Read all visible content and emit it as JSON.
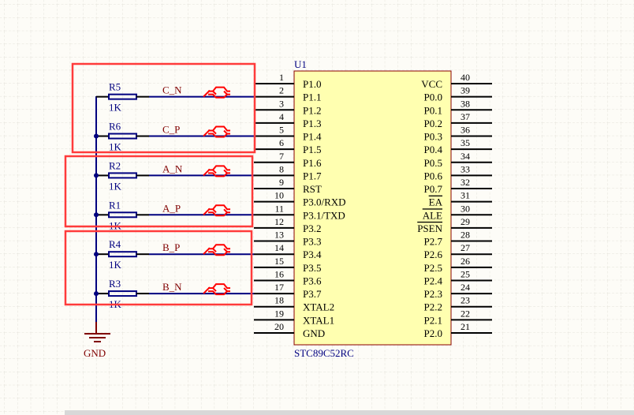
{
  "colors": {
    "background": "#fdfcf7",
    "grid": "#e4e2da",
    "wire": "#00007f",
    "pin": "#000000",
    "chip_fill": "#ffffb0",
    "chip_border": "#8b0000",
    "ref_text": "#000080",
    "net_text": "#800000",
    "highlight_box": "#ff3b3b",
    "port_symbol": "#ff0000"
  },
  "chip": {
    "designator": "U1",
    "part": "STC89C52RC",
    "left_pins": [
      {
        "num": "1",
        "name": "P1.0"
      },
      {
        "num": "2",
        "name": "P1.1"
      },
      {
        "num": "3",
        "name": "P1.2"
      },
      {
        "num": "4",
        "name": "P1.3"
      },
      {
        "num": "5",
        "name": "P1.4"
      },
      {
        "num": "6",
        "name": "P1.5"
      },
      {
        "num": "7",
        "name": "P1.6"
      },
      {
        "num": "8",
        "name": "P1.7"
      },
      {
        "num": "9",
        "name": "RST"
      },
      {
        "num": "10",
        "name": "P3.0/RXD"
      },
      {
        "num": "11",
        "name": "P3.1/TXD"
      },
      {
        "num": "12",
        "name": "P3.2"
      },
      {
        "num": "13",
        "name": "P3.3"
      },
      {
        "num": "14",
        "name": "P3.4"
      },
      {
        "num": "15",
        "name": "P3.5"
      },
      {
        "num": "16",
        "name": "P3.6"
      },
      {
        "num": "17",
        "name": "P3.7"
      },
      {
        "num": "18",
        "name": "XTAL2"
      },
      {
        "num": "19",
        "name": "XTAL1"
      },
      {
        "num": "20",
        "name": "GND"
      }
    ],
    "right_pins": [
      {
        "num": "40",
        "name": "VCC"
      },
      {
        "num": "39",
        "name": "P0.0"
      },
      {
        "num": "38",
        "name": "P0.1"
      },
      {
        "num": "37",
        "name": "P0.2"
      },
      {
        "num": "36",
        "name": "P0.3"
      },
      {
        "num": "35",
        "name": "P0.4"
      },
      {
        "num": "34",
        "name": "P0.5"
      },
      {
        "num": "33",
        "name": "P0.6"
      },
      {
        "num": "32",
        "name": "P0.7"
      },
      {
        "num": "31",
        "name": "EA",
        "overbar": true
      },
      {
        "num": "30",
        "name": "ALE",
        "overbar": true
      },
      {
        "num": "29",
        "name": "PSEN",
        "overbar": true
      },
      {
        "num": "28",
        "name": "P2.7"
      },
      {
        "num": "27",
        "name": "P2.6"
      },
      {
        "num": "26",
        "name": "P2.5"
      },
      {
        "num": "25",
        "name": "P2.4"
      },
      {
        "num": "24",
        "name": "P2.3"
      },
      {
        "num": "23",
        "name": "P2.2"
      },
      {
        "num": "22",
        "name": "P2.1"
      },
      {
        "num": "21",
        "name": "P2.0"
      }
    ]
  },
  "resistors": [
    {
      "ref": "R5",
      "value": "1K",
      "net": "C_N",
      "pin": 2
    },
    {
      "ref": "R6",
      "value": "1K",
      "net": "C_P",
      "pin": 5
    },
    {
      "ref": "R2",
      "value": "1K",
      "net": "A_N",
      "pin": 8
    },
    {
      "ref": "R1",
      "value": "1K",
      "net": "A_P",
      "pin": 11
    },
    {
      "ref": "R4",
      "value": "1K",
      "net": "B_P",
      "pin": 14
    },
    {
      "ref": "R3",
      "value": "1K",
      "net": "B_N",
      "pin": 17
    }
  ],
  "ground": {
    "label": "GND"
  },
  "highlight_groups": [
    "C",
    "A",
    "B"
  ]
}
